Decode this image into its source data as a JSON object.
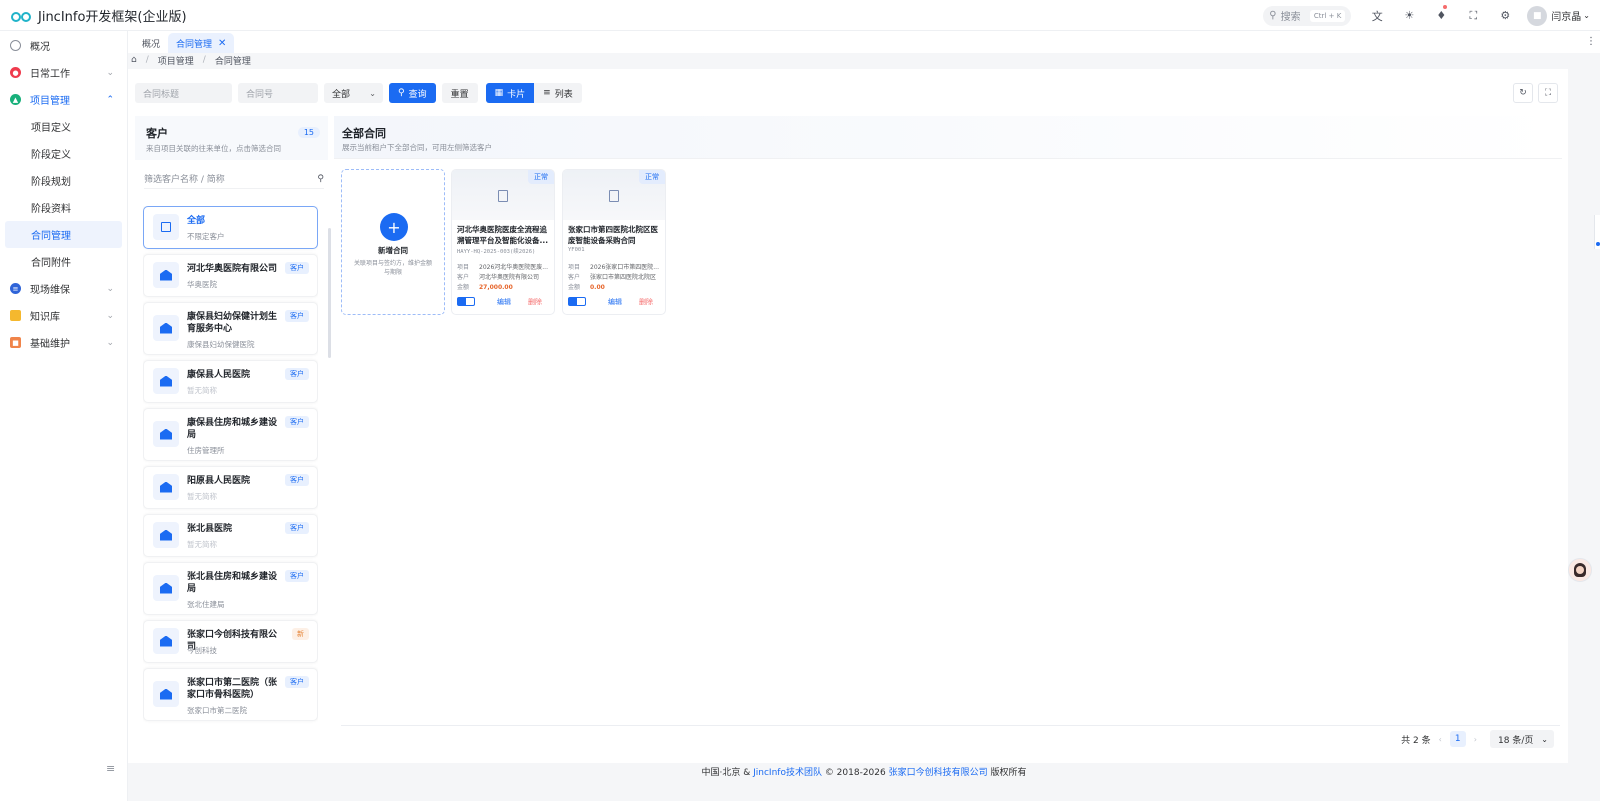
{
  "app": {
    "title": "JincInfo开发框架(企业版)"
  },
  "header": {
    "search_placeholder": "搜索",
    "search_shortcut": "Ctrl + K",
    "icons": [
      "translate-icon",
      "sun-icon",
      "bell-icon",
      "fullscreen-icon",
      "gear-icon"
    ],
    "user_name": "闫京晶"
  },
  "sidebar": {
    "items": [
      {
        "label": "概况",
        "icon": "dashboard-icon",
        "color": "#8a8f99"
      },
      {
        "label": "日常工作",
        "icon": "daily-icon",
        "color": "#ef3b4d"
      },
      {
        "label": "项目管理",
        "icon": "project-icon",
        "color": "#18b07b"
      },
      {
        "label": "现场维保",
        "icon": "maintenance-icon",
        "color": "#2f64d8"
      },
      {
        "label": "知识库",
        "icon": "folder-icon",
        "color": "#f5b82e"
      },
      {
        "label": "基础维护",
        "icon": "basic-icon",
        "color": "#f0844a"
      }
    ],
    "project_sub": [
      "项目定义",
      "阶段定义",
      "阶段规划",
      "阶段资料",
      "合同管理",
      "合同附件"
    ]
  },
  "tabs": [
    {
      "label": "概况"
    },
    {
      "label": "合同管理"
    }
  ],
  "breadcrumb": [
    "项目管理",
    "合同管理"
  ],
  "toolbar": {
    "title_placeholder": "合同标题",
    "number_placeholder": "合同号",
    "status_value": "全部",
    "query_label": "查询",
    "reset_label": "重置",
    "card_label": "卡片",
    "list_label": "列表"
  },
  "customers": {
    "title": "客户",
    "subtitle": "来自项目关联的往来单位，点击筛选合同",
    "count": "15",
    "search_placeholder": "筛选客户名称 / 简称",
    "all": {
      "name": "全部",
      "sub": "不限定客户"
    },
    "items": [
      {
        "name": "河北华奥医院有限公司",
        "sub": "华奥医院",
        "tag": "客户"
      },
      {
        "name": "康保县妇幼保健计划生育服务中心",
        "sub": "康保县妇幼保健医院",
        "tag": "客户"
      },
      {
        "name": "康保县人民医院",
        "sub": "暂无简称",
        "tag": "客户"
      },
      {
        "name": "康保县住房和城乡建设局",
        "sub": "住房管理所",
        "tag": "客户"
      },
      {
        "name": "阳原县人民医院",
        "sub": "暂无简称",
        "tag": "客户"
      },
      {
        "name": "张北县医院",
        "sub": "暂无简称",
        "tag": "客户"
      },
      {
        "name": "张北县住房和城乡建设局",
        "sub": "张北住建局",
        "tag": "客户"
      },
      {
        "name": "张家口今创科技有限公司",
        "sub": "今创科技",
        "tag": "新"
      },
      {
        "name": "张家口市第二医院（张家口市骨科医院）",
        "sub": "张家口市第二医院",
        "tag": "客户"
      }
    ]
  },
  "contracts": {
    "title": "全部合同",
    "subtitle": "展示当前租户下全部合同，可用左侧筛选客户",
    "add": {
      "title": "新增合同",
      "sub": "关联项目与签约方，维护金额与期限"
    },
    "cards": [
      {
        "status": "正常",
        "name": "河北华奥医院医废全流程追溯管理平台及智能化设备...",
        "code": "HAYY-HQ-2025-003(续2026)",
        "project_label": "项目",
        "project": "2026河北华奥医院医废...",
        "customer_label": "客户",
        "customer": "河北华奥医院有限公司",
        "amount_label": "金额",
        "amount": "27,000.00",
        "edit": "编辑",
        "delete": "删除"
      },
      {
        "status": "正常",
        "name": "张家口市第四医院北院区医废智能设备采购合同",
        "code": "YF001",
        "project_label": "项目",
        "project": "2026张家口市第四医院...",
        "customer_label": "客户",
        "customer": "张家口市第四医院北院区",
        "amount_label": "金额",
        "amount": "0.00",
        "edit": "编辑",
        "delete": "删除"
      }
    ]
  },
  "pager": {
    "total": "共 2 条",
    "page": "1",
    "size": "18 条/页"
  },
  "footer": {
    "prefix": "中国·北京 & ",
    "team": "JincInfo技术团队",
    "middle": " © 2018-2026 ",
    "company": "张家口今创科技有限公司",
    "suffix": " 版权所有"
  },
  "colors": {
    "accent": "#1b6bf2",
    "logo": "#20b3c9",
    "danger": "#f56c6c",
    "amount": "#e6642a"
  }
}
